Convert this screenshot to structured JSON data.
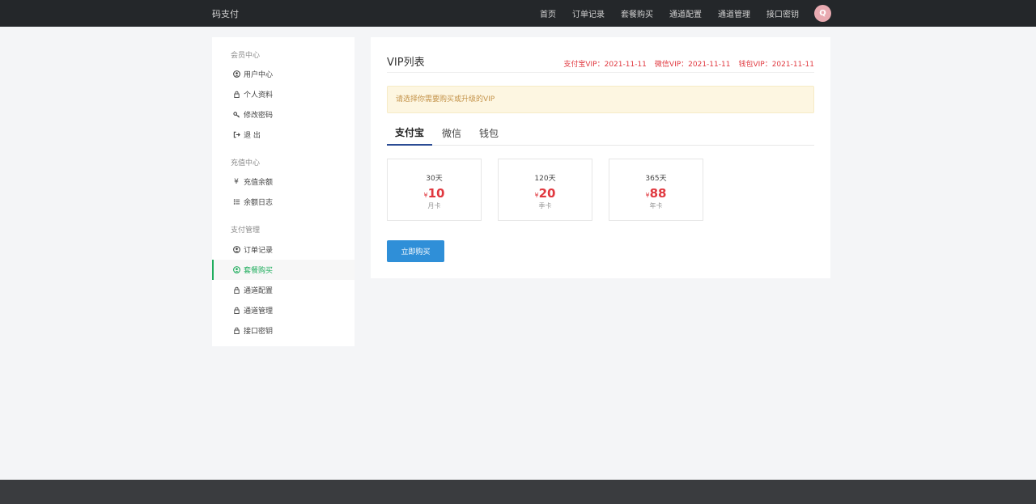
{
  "header": {
    "brand": "码支付",
    "nav": [
      "首页",
      "订单记录",
      "套餐购买",
      "通道配置",
      "通道管理",
      "接口密钥"
    ],
    "avatar_letter": "Q",
    "avatar_color": "#e8aab1"
  },
  "sidebar": {
    "groups": [
      {
        "title": "会员中心",
        "items": [
          {
            "label": "用户中心",
            "icon": "user-circle-icon"
          },
          {
            "label": "个人资料",
            "icon": "lock-icon"
          },
          {
            "label": "修改密码",
            "icon": "key-icon"
          },
          {
            "label": "退 出",
            "icon": "sign-out-icon"
          }
        ]
      },
      {
        "title": "充值中心",
        "items": [
          {
            "label": "充值余额",
            "icon": "yen-icon"
          },
          {
            "label": "余额日志",
            "icon": "list-icon"
          }
        ]
      },
      {
        "title": "支付管理",
        "items": [
          {
            "label": "订单记录",
            "icon": "user-circle-icon"
          },
          {
            "label": "套餐购买",
            "icon": "user-circle-icon",
            "active": true
          },
          {
            "label": "通道配置",
            "icon": "lock-icon"
          },
          {
            "label": "通道管理",
            "icon": "lock-icon"
          },
          {
            "label": "接口密钥",
            "icon": "lock-icon"
          }
        ]
      }
    ],
    "active_color": "#1fad5d"
  },
  "main": {
    "title": "VIP列表",
    "vip_status": [
      "支付宝VIP：2021-11-11",
      "微信VIP：2021-11-11",
      "钱包VIP：2021-11-11"
    ],
    "notice": "请选择你需要购买或升级的VIP",
    "tabs": [
      "支付宝",
      "微信",
      "钱包"
    ],
    "active_tab": 0,
    "plans": [
      {
        "days": "30天",
        "symbol": "¥",
        "price": "10",
        "name": "月卡"
      },
      {
        "days": "120天",
        "symbol": "¥",
        "price": "20",
        "name": "季卡"
      },
      {
        "days": "365天",
        "symbol": "¥",
        "price": "88",
        "name": "年卡"
      }
    ],
    "buy_button": "立即购买"
  },
  "colors": {
    "topbar": "#24272a",
    "price_red": "#e0383f",
    "button_blue": "#2f8fd8",
    "tab_underline": "#2b4c94"
  }
}
